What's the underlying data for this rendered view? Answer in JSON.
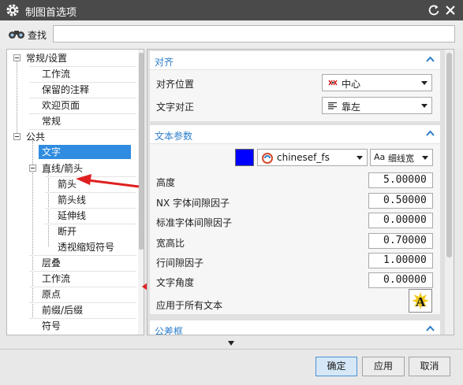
{
  "window": {
    "title": "制图首选项"
  },
  "search": {
    "label": "查找",
    "value": ""
  },
  "tree": {
    "items": [
      {
        "label": "常规/设置",
        "level": 0,
        "expanded": true
      },
      {
        "label": "工作流",
        "level": 1
      },
      {
        "label": "保留的注释",
        "level": 1
      },
      {
        "label": "欢迎页面",
        "level": 1
      },
      {
        "label": "常规",
        "level": 1
      },
      {
        "label": "公共",
        "level": 0,
        "expanded": true
      },
      {
        "label": "文字",
        "level": 1,
        "selected": true
      },
      {
        "label": "直线/箭头",
        "level": 1,
        "expanded": true
      },
      {
        "label": "箭头",
        "level": 2
      },
      {
        "label": "箭头线",
        "level": 2
      },
      {
        "label": "延伸线",
        "level": 2
      },
      {
        "label": "断开",
        "level": 2
      },
      {
        "label": "透视缩短符号",
        "level": 2
      },
      {
        "label": "层叠",
        "level": 1
      },
      {
        "label": "工作流",
        "level": 1
      },
      {
        "label": "原点",
        "level": 1
      },
      {
        "label": "前缀/后缀",
        "level": 1
      },
      {
        "label": "符号",
        "level": 1
      }
    ]
  },
  "align_section": {
    "title": "对齐",
    "position_label": "对齐位置",
    "position_value": "中心",
    "justify_label": "文字对正",
    "justify_value": "靠左"
  },
  "text_params_section": {
    "title": "文本参数",
    "font_value": "chinesef_fs",
    "width_value": "细线宽",
    "color": "#0000ff",
    "params": [
      {
        "label": "高度",
        "value": "5.00000"
      },
      {
        "label": "NX 字体间隙因子",
        "value": "0.50000"
      },
      {
        "label": "标准字体间隙因子",
        "value": "0.00000"
      },
      {
        "label": "宽高比",
        "value": "0.70000"
      },
      {
        "label": "行间隙因子",
        "value": "1.00000"
      },
      {
        "label": "文字角度",
        "value": "0.00000"
      }
    ],
    "apply_all_label": "应用于所有文本"
  },
  "tolerance_section": {
    "title": "公差框"
  },
  "buttons": {
    "ok": "确定",
    "apply": "应用",
    "cancel": "取消"
  },
  "colors": {
    "accent": "#2c7dc9",
    "selection": "#2f8ce0",
    "titlebar": "#4a4a4a",
    "annotation": "#e02020"
  }
}
